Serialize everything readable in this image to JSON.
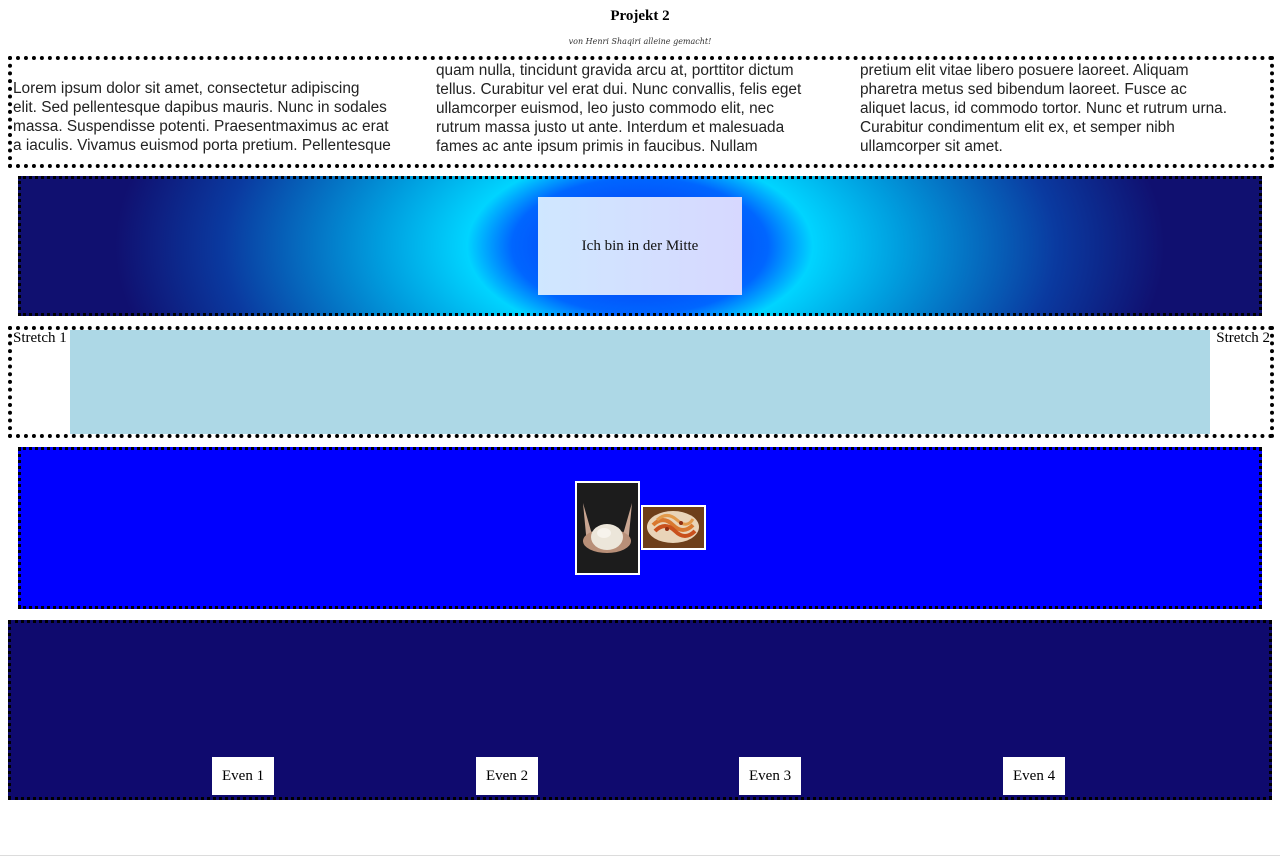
{
  "header": {
    "title": "Projekt 2",
    "subtitle": "von Henri Shaqiri alleine gemacht!"
  },
  "text_section": {
    "col1": [
      "Lorem ipsum dolor sit amet, consectetur adipiscing",
      "elit. Sed pellentesque dapibus mauris. Nunc in sodales",
      "massa. Suspendisse potenti. Praesentmaximus ac erat",
      "a iaculis. Vivamus euismod porta pretium. Pellentesque"
    ],
    "col2": [
      "quam nulla, tincidunt gravida arcu at, porttitor dictum",
      "tellus. Curabitur vel erat dui. Nunc convallis, felis eget",
      "ullamcorper euismod, leo justo commodo elit, nec",
      "rutrum massa justo ut ante. Interdum et malesuada",
      "fames ac ante ipsum primis in faucibus. Nullam"
    ],
    "col3": [
      "pretium elit vitae libero posuere laoreet. Aliquam",
      "pharetra metus sed bibendum laoreet. Fusce ac",
      "aliquet lacus, id commodo tortor. Nunc et rutrum urna.",
      "Curabitur condimentum elit ex, et semper nibh",
      "ullamcorper sit amet."
    ]
  },
  "center_section": {
    "label": "Ich bin in der Mitte"
  },
  "stretch_section": {
    "item1": "Stretch 1",
    "item2": "Stretch 2"
  },
  "image_section": {
    "images": [
      "dough-photo",
      "pasta-photo"
    ]
  },
  "even_section": {
    "items": [
      "Even 1",
      "Even 2",
      "Even 3",
      "Even 4"
    ]
  },
  "colors": {
    "stretch_fill": "#add8e6",
    "image_bg": "#0000ff",
    "even_bg": "#0f0a6e"
  }
}
